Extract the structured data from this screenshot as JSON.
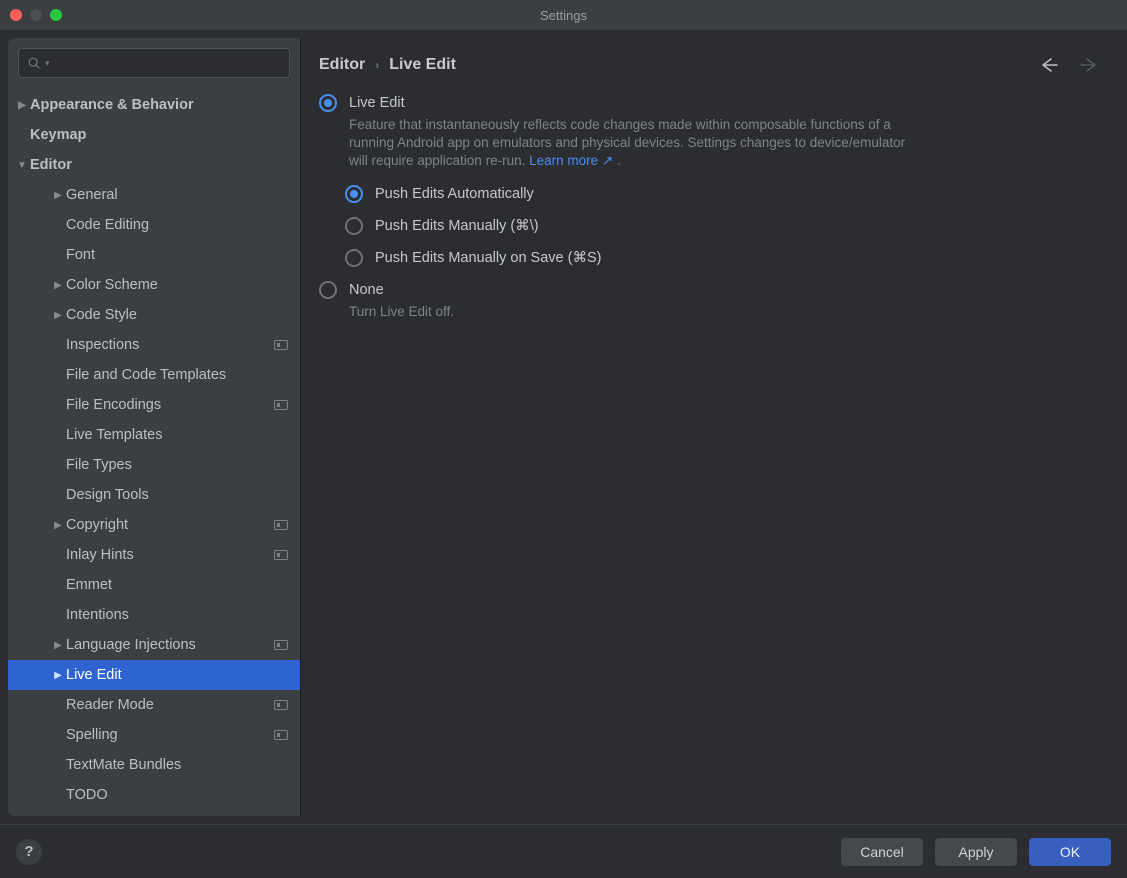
{
  "window": {
    "title": "Settings"
  },
  "search": {
    "placeholder": ""
  },
  "sidebar": {
    "items": [
      {
        "label": "Appearance & Behavior",
        "indent": 0,
        "chev": "right",
        "bold": true
      },
      {
        "label": "Keymap",
        "indent": 0,
        "chev": "",
        "bold": true
      },
      {
        "label": "Editor",
        "indent": 0,
        "chev": "down",
        "bold": true
      },
      {
        "label": "General",
        "indent": 1,
        "chev": "right"
      },
      {
        "label": "Code Editing",
        "indent": 1,
        "chev": ""
      },
      {
        "label": "Font",
        "indent": 1,
        "chev": ""
      },
      {
        "label": "Color Scheme",
        "indent": 1,
        "chev": "right"
      },
      {
        "label": "Code Style",
        "indent": 1,
        "chev": "right"
      },
      {
        "label": "Inspections",
        "indent": 1,
        "chev": "",
        "badge": true
      },
      {
        "label": "File and Code Templates",
        "indent": 1,
        "chev": ""
      },
      {
        "label": "File Encodings",
        "indent": 1,
        "chev": "",
        "badge": true
      },
      {
        "label": "Live Templates",
        "indent": 1,
        "chev": ""
      },
      {
        "label": "File Types",
        "indent": 1,
        "chev": ""
      },
      {
        "label": "Design Tools",
        "indent": 1,
        "chev": ""
      },
      {
        "label": "Copyright",
        "indent": 1,
        "chev": "right",
        "badge": true
      },
      {
        "label": "Inlay Hints",
        "indent": 1,
        "chev": "",
        "badge": true
      },
      {
        "label": "Emmet",
        "indent": 1,
        "chev": ""
      },
      {
        "label": "Intentions",
        "indent": 1,
        "chev": ""
      },
      {
        "label": "Language Injections",
        "indent": 1,
        "chev": "right",
        "badge": true
      },
      {
        "label": "Live Edit",
        "indent": 1,
        "chev": "right",
        "selected": true
      },
      {
        "label": "Reader Mode",
        "indent": 1,
        "chev": "",
        "badge": true
      },
      {
        "label": "Spelling",
        "indent": 1,
        "chev": "",
        "badge": true
      },
      {
        "label": "TextMate Bundles",
        "indent": 1,
        "chev": ""
      },
      {
        "label": "TODO",
        "indent": 1,
        "chev": ""
      }
    ]
  },
  "breadcrumb": {
    "parent": "Editor",
    "current": "Live Edit"
  },
  "options": {
    "liveEdit": {
      "label": "Live Edit",
      "checked": true,
      "desc_pre": "Feature that instantaneously reflects code changes made within composable functions of a running Android app on emulators and physical devices. Settings changes to device/emulator will require application re-run. ",
      "learn_more": "Learn more",
      "desc_post": " ."
    },
    "pushModes": [
      {
        "label": "Push Edits Automatically",
        "checked": true
      },
      {
        "label": "Push Edits Manually (⌘\\)",
        "checked": false
      },
      {
        "label": "Push Edits Manually on Save (⌘S)",
        "checked": false
      }
    ],
    "none": {
      "label": "None",
      "checked": false,
      "desc": "Turn Live Edit off."
    }
  },
  "footer": {
    "help": "?",
    "cancel": "Cancel",
    "apply": "Apply",
    "ok": "OK"
  }
}
